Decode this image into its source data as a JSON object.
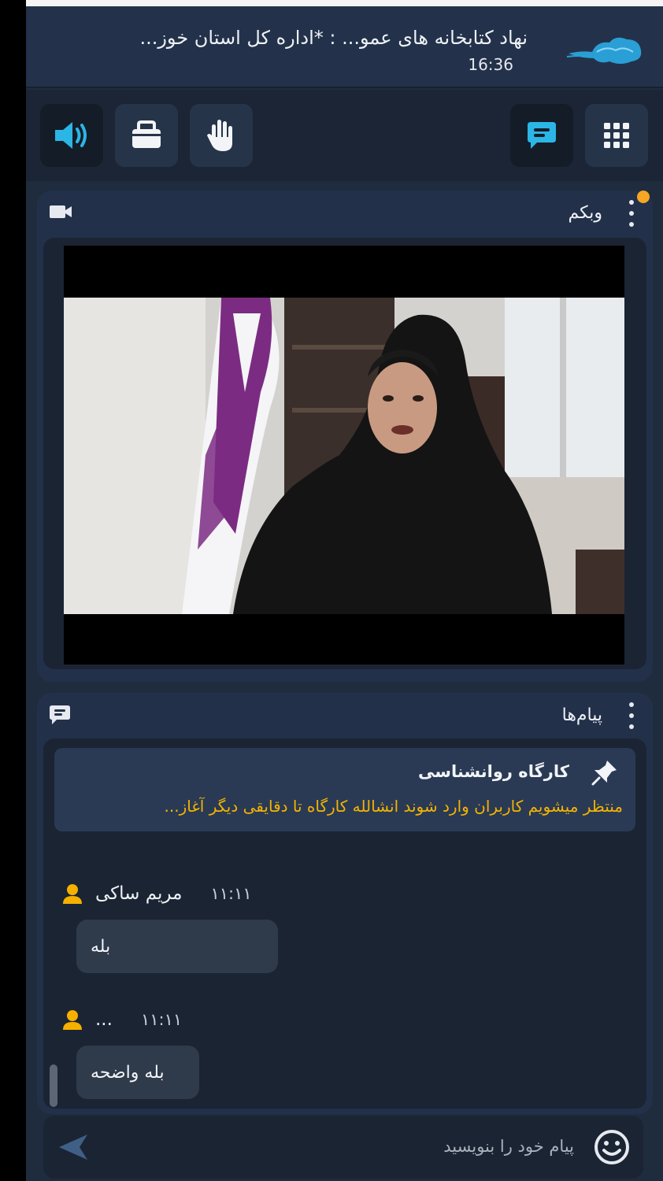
{
  "header": {
    "title": "نهاد کتابخانه های عمو... : *اداره کل استان خوز...",
    "time": "16:36",
    "logo_icon": "cloud-logo-icon"
  },
  "toolbar": {
    "left_buttons": [
      "speaker-icon",
      "camera-toggle-icon",
      "raise-hand-icon"
    ],
    "right_buttons": [
      "chat-icon",
      "apps-grid-icon"
    ],
    "accent_color": "#2bb6e6"
  },
  "webcam_panel": {
    "title": "وبکم",
    "icon": "video-camera-icon",
    "notification_color": "#f5a623"
  },
  "messages_panel": {
    "title": "پیام‌ها",
    "icon": "message-icon",
    "pinned": {
      "title": "کارگاه روانشناسی",
      "text": "منتظر میشویم کاربران وارد شوند انشالله کارگاه تا دقایقی دیگر آغاز..."
    },
    "messages": [
      {
        "name": "مریم ساکی",
        "time": "۱۱:۱۱",
        "text": "بله"
      },
      {
        "name": "...",
        "time": "۱۱:۱۱",
        "text": "بله واضحه"
      }
    ]
  },
  "composer": {
    "placeholder": "پیام خود را بنویسید",
    "emoji_icon": "emoji-icon",
    "send_icon": "send-icon"
  }
}
